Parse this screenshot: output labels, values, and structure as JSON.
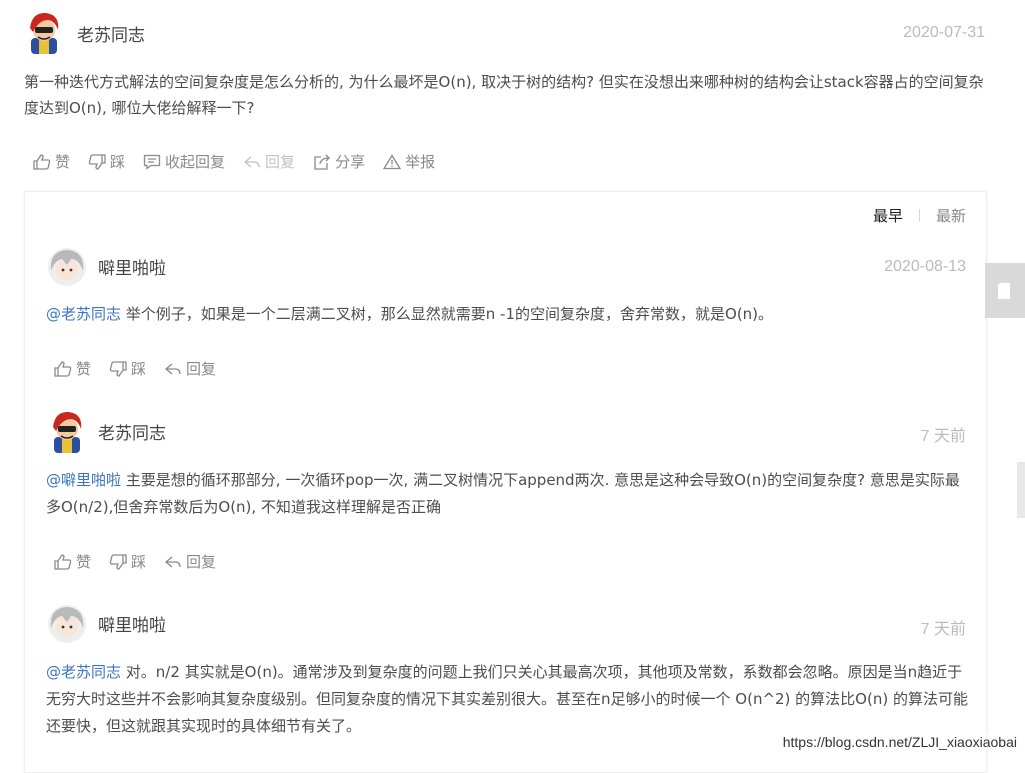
{
  "comment": {
    "username": "老苏同志",
    "date": "2020-07-31",
    "text": "第一种迭代方式解法的空间复杂度是怎么分析的, 为什么最坏是O(n), 取决于树的结构? 但实在没想出来哪种树的结构会让stack容器占的空间复杂度达到O(n), 哪位大佬给解释一下?",
    "actions": {
      "like": "赞",
      "dislike": "踩",
      "collapse": "收起回复",
      "reply": "回复",
      "share": "分享",
      "report": "举报"
    }
  },
  "sort": {
    "earliest": "最早",
    "latest": "最新"
  },
  "replies": [
    {
      "username": "噼里啪啦",
      "date": "2020-08-13",
      "mention": "@老苏同志",
      "text": " 举个例子，如果是一个二层满二叉树，那么显然就需要n -1的空间复杂度，舍弃常数，就是O(n)。",
      "like": "赞",
      "dislike": "踩",
      "reply": "回复",
      "avatar": "grey-hair-avatar"
    },
    {
      "username": "老苏同志",
      "date": "7 天前",
      "mention": "@噼里啪啦",
      "text": " 主要是想的循环那部分, 一次循环pop一次, 满二叉树情况下append两次. 意思是这种会导致O(n)的空间复杂度? 意思是实际最多O(n/2),但舍弃常数后为O(n), 不知道我这样理解是否正确",
      "like": "赞",
      "dislike": "踩",
      "reply": "回复",
      "avatar": "red-hair-avatar"
    },
    {
      "username": "噼里啪啦",
      "date": "7 天前",
      "mention": "@老苏同志",
      "text": " 对。n/2 其实就是O(n)。通常涉及到复杂度的问题上我们只关心其最高次项，其他项及常数，系数都会忽略。原因是当n趋近于无穷大时这些并不会影响其复杂度级别。但同复杂度的情况下其实差别很大。甚至在n足够小的时候一个 O(n^2) 的算法比O(n) 的算法可能还要快，但这就跟其实现时的具体细节有关了。",
      "avatar": "grey-hair-avatar"
    }
  ],
  "watermark": "https://blog.csdn.net/ZLJI_xiaoxiaobai",
  "colors": {
    "mention": "#3a76c4",
    "muted": "#8a8a8a",
    "date": "#bbbbbb"
  }
}
